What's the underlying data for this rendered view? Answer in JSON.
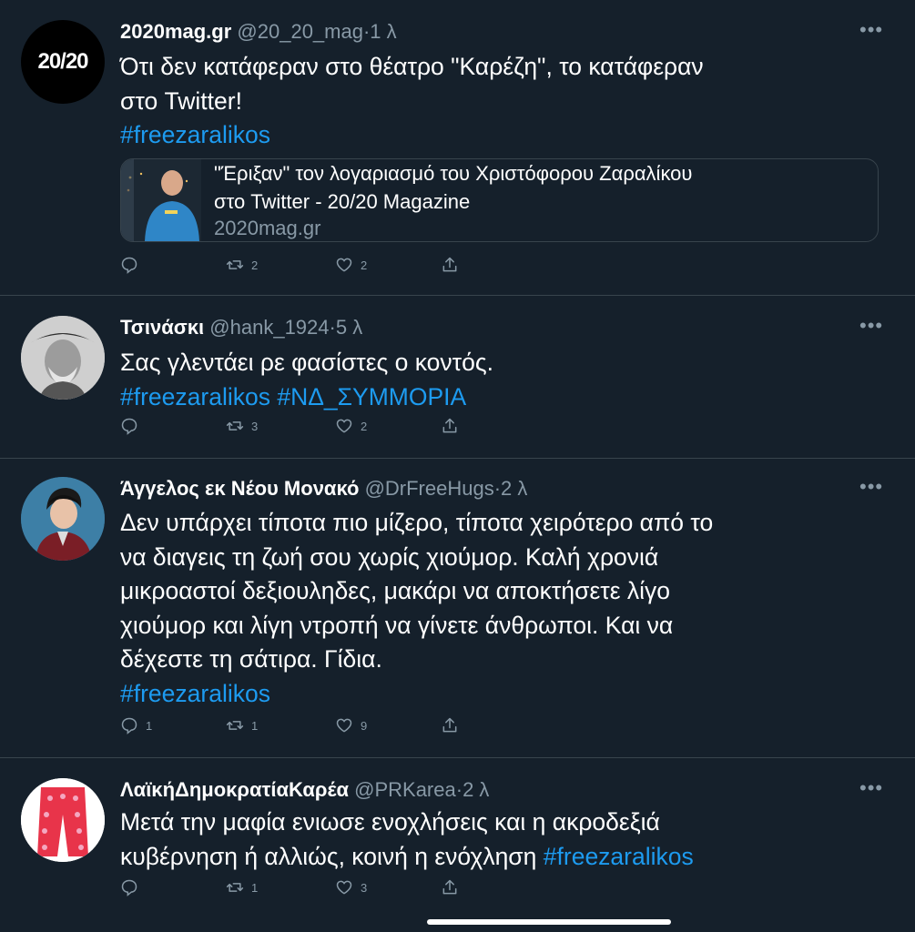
{
  "colors": {
    "background": "#15202b",
    "text": "#ffffff",
    "muted": "#8899a6",
    "link": "#1d9bf0",
    "divider": "#38444d"
  },
  "tweets": [
    {
      "name": "2020mag.gr",
      "handle": "@20_20_mag",
      "time": "1 λ",
      "avatar_text": "20/20",
      "lines": [
        "Ότι δεν κατάφεραν στο θέατρο \"Καρέζη\", το κατάφεραν",
        "στο Twitter!"
      ],
      "hashtags": [
        "#freezaralikos"
      ],
      "card": {
        "title_line1": "\"Έριξαν\" τον λογαριασμό του Χριστόφορου Ζαραλίκου",
        "title_line2": "στο Twitter - 20/20 Magazine",
        "domain": "2020mag.gr"
      },
      "replies": "",
      "retweets": "2",
      "likes": "2"
    },
    {
      "name": "Τσινάσκι",
      "handle": "@hank_1924",
      "time": "5 λ",
      "lines": [
        "Σας γλεντάει ρε φασίστες ο κοντός."
      ],
      "hashtags": [
        "#freezaralikos",
        "#ΝΔ_ΣΥΜΜΟΡΙΑ"
      ],
      "replies": "",
      "retweets": "3",
      "likes": "2"
    },
    {
      "name": "Άγγελος εκ Νέου Μονακό",
      "handle": "@DrFreeHugs",
      "time": "2 λ",
      "lines": [
        "Δεν υπάρχει τίποτα πιο μίζερο, τίποτα χειρότερο από το",
        "να διαγεις τη ζωή σου χωρίς χιούμορ. Καλή χρονιά",
        "μικροαστοί δεξιουληδες, μακάρι να αποκτήσετε λίγο",
        "χιούμορ και λίγη ντροπή να γίνετε άνθρωποι. Και να",
        "δέχεστε τη σάτιρα. Γίδια."
      ],
      "hashtags": [
        "#freezaralikos"
      ],
      "replies": "1",
      "retweets": "1",
      "likes": "9"
    },
    {
      "name": "ΛαϊκήΔημοκρατίαΚαρέα",
      "handle": "@PRKarea",
      "time": "2 λ",
      "lines": [
        "Μετά την μαφία ενιωσε ενοχλήσεις και η ακροδεξιά",
        "κυβέρνηση ή αλλιώς, κοινή η ενόχληση"
      ],
      "hashtags": [
        "#freezaralikos"
      ],
      "replies": "",
      "retweets": "1",
      "likes": "3"
    }
  ]
}
